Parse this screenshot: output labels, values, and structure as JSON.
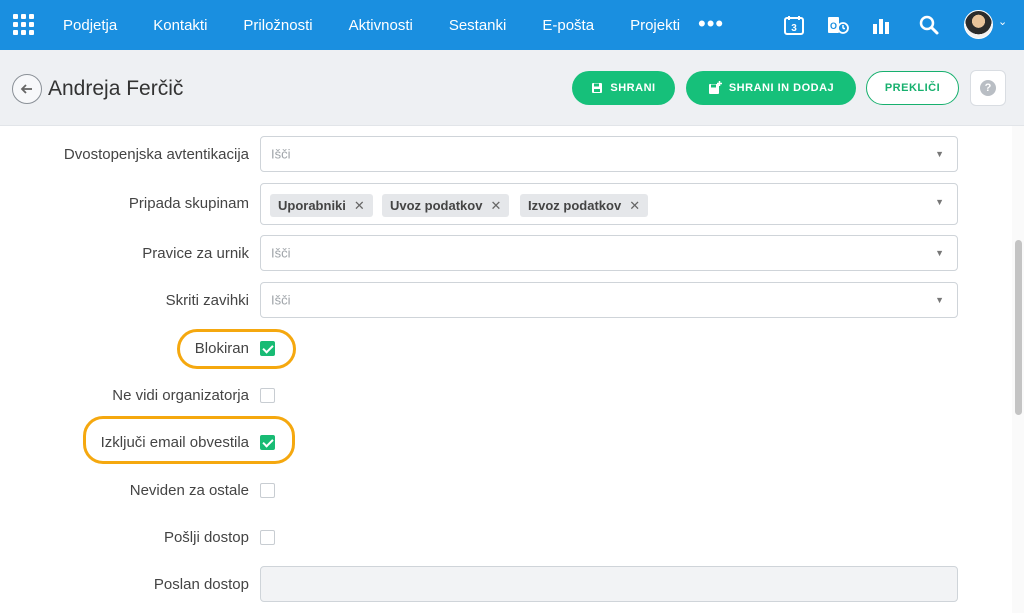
{
  "nav": {
    "items": [
      "Podjetja",
      "Kontakti",
      "Priložnosti",
      "Aktivnosti",
      "Sestanki",
      "E-pošta",
      "Projekti"
    ],
    "more": "•••",
    "calendar_day": "3",
    "icons": [
      "apps-grid-icon",
      "calendar-icon",
      "outlook-sync-icon",
      "reports-icon",
      "search-icon"
    ]
  },
  "header": {
    "title": "Andreja Ferčič",
    "save": "SHRANI",
    "save_add": "SHRANI IN DODAJ",
    "cancel": "PREKLIČI",
    "help": "?"
  },
  "form": {
    "two_factor": {
      "label": "Dvostopenjska avtentikacija",
      "placeholder": "Išči"
    },
    "groups": {
      "label": "Pripada skupinam",
      "tags": [
        "Uporabniki",
        "Uvoz podatkov",
        "Izvoz podatkov"
      ],
      "remove": "✕"
    },
    "schedule_rights": {
      "label": "Pravice za urnik",
      "placeholder": "Išči"
    },
    "hidden_tabs": {
      "label": "Skriti zavihki",
      "placeholder": "Išči"
    },
    "blocked": {
      "label": "Blokiran",
      "checked": true
    },
    "hide_organizer": {
      "label": "Ne vidi organizatorja",
      "checked": false
    },
    "disable_email": {
      "label": "Izključi email obvestila",
      "checked": true
    },
    "invisible": {
      "label": "Neviden za ostale",
      "checked": false
    },
    "send_access": {
      "label": "Pošlji dostop",
      "checked": false
    },
    "access_sent": {
      "label": "Poslan dostop",
      "value": ""
    }
  },
  "colors": {
    "nav": "#1a8fe0",
    "accent": "#16c07a",
    "highlight": "#f5a80f"
  }
}
